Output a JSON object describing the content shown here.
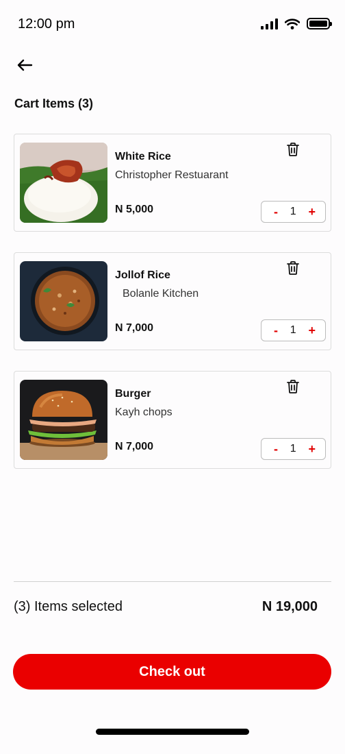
{
  "status_bar": {
    "time": "12:00 pm",
    "icons": [
      "signal-icon",
      "wifi-icon",
      "battery-icon"
    ]
  },
  "header": {
    "back_icon": "arrow-left-icon",
    "title": "Cart Items (3)"
  },
  "cart": {
    "items": [
      {
        "name": "White Rice",
        "restaurant": "Christopher Restuarant",
        "price": "N 5,000",
        "quantity": "1",
        "minus": "-",
        "plus": "+",
        "image": "white-rice-with-chicken-image"
      },
      {
        "name": "Jollof Rice",
        "restaurant": "Bolanle Kitchen",
        "price": "N 7,000",
        "quantity": "1",
        "minus": "-",
        "plus": "+",
        "image": "jollof-rice-bowl-image"
      },
      {
        "name": "Burger",
        "restaurant": "Kayh chops",
        "price": "N 7,000",
        "quantity": "1",
        "minus": "-",
        "plus": "+",
        "image": "burger-image"
      }
    ]
  },
  "summary": {
    "items_selected": "(3) Items selected",
    "total": "N 19,000"
  },
  "checkout": {
    "label": "Check out"
  },
  "colors": {
    "accent": "#ea0000",
    "background": "#fdfcfd",
    "border": "#dcdcdc"
  }
}
